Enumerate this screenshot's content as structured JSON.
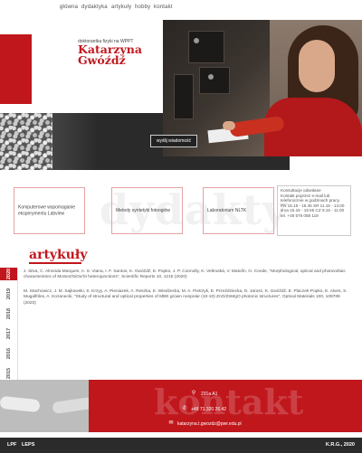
{
  "nav": {
    "items": [
      {
        "label": "główna"
      },
      {
        "label": "dydaktyka"
      },
      {
        "label": "artykuły"
      },
      {
        "label": "hobby"
      },
      {
        "label": "kontakt"
      }
    ]
  },
  "hero": {
    "subtitle": "doktorantka fizyki na WPPT",
    "name_line1": "Katarzyna",
    "name_line2": "Gwóźdź",
    "message_button": "wyślij wiadomość"
  },
  "teaching": {
    "background_word": "dydakty",
    "boxes": [
      {
        "label": "Komputerowe wspomaganie eksperymentu Labview"
      },
      {
        "label": "Metody syntetyki fotoogiów"
      },
      {
        "label": "Laboratorium NLTK"
      }
    ],
    "hours": "Konsultacje odwołane\nKontakt poprzez e-mail lub telefonicznie w godzinach pracy.\nPN 15.15 - 16.45 SR 11.15 - 13.00 sroa 15.15 - 16.55 CZ 9.15 - 11.00\ntel. +48 576 058 119"
  },
  "articles": {
    "heading": "artykuły",
    "years": [
      "2020",
      "2019",
      "2018",
      "2017",
      "2016",
      "2015"
    ],
    "active_year": "2020",
    "refs": [
      {
        "text": "J. Silva, C. Almeida Marques, A. S. Viana, I. F. Santos, K. Gwóźdź, E. Popko, J. P. Connolly, K. Veltruská, V. Matolín, O. Conde, \"Morphological, optical and photovoltaic characteristics of MoSe2/SiOx/Si heterojunctions\", Scientific Reports 10, 1215 (2020)"
      },
      {
        "text": "M. Stachowicz, J. M. Sajkowski, S. Krzyy, A. Pieniazek, A. Reszka, K. Wiedżecka, M. A. Pietrzyk, E. Przeździecka, D. Jarosz, K. Gwóźdź, E. Placzek-Popko, E. Alves, S. Mugalfrilev, A. Kozanecki, \"Study of structural and optical properties of MBE grown nonpolar (10-10) ZnO/ZnMgO photonic structures\", Optical Materials 100, 109789 (2020)"
      }
    ]
  },
  "contact": {
    "background_word": "kontakt",
    "room": "231a A1",
    "phone": "+48 71 320 26 42",
    "email": "katarzyna.t.gwozdz@pwr.edu.pl"
  },
  "footer": {
    "left1": "LPF",
    "left2": "LEPS",
    "right": "K.R.G., 2020"
  },
  "colors": {
    "accent": "#c0171d",
    "dark": "#2a2a2a"
  }
}
